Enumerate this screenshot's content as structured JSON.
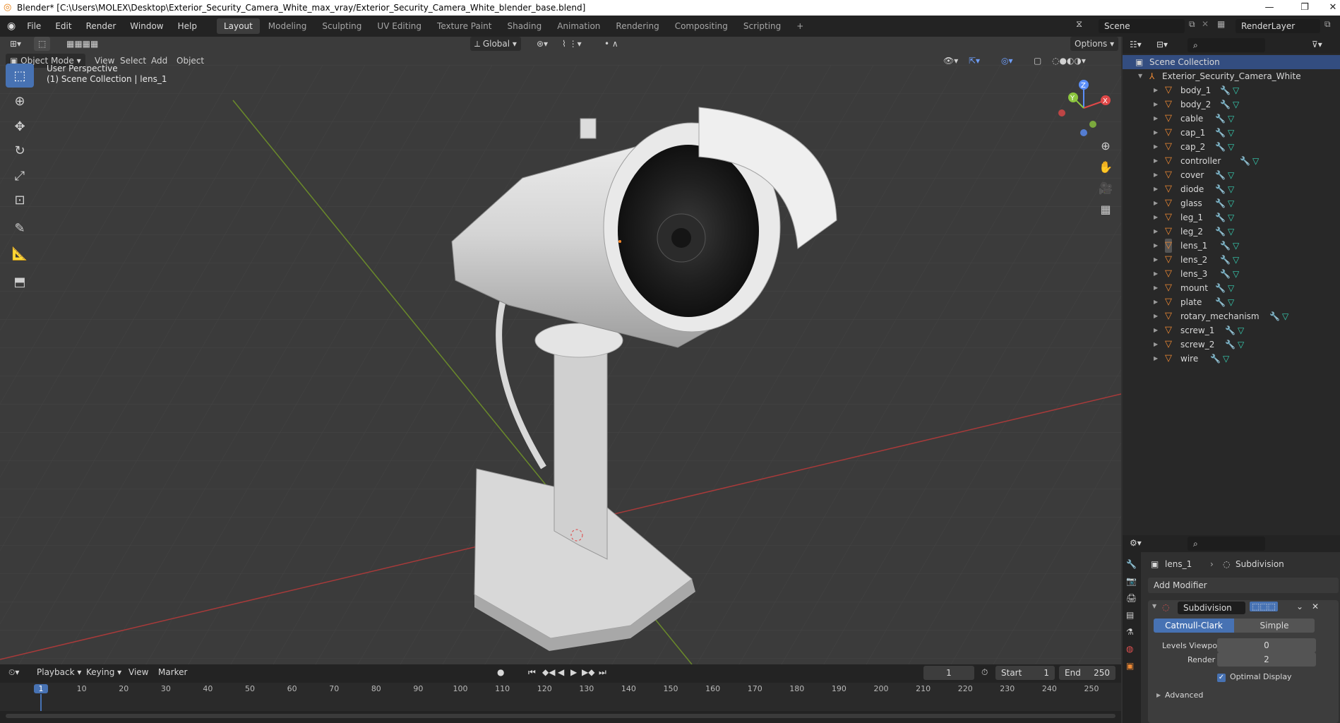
{
  "window": {
    "title": "Blender* [C:\\Users\\MOLEX\\Desktop\\Exterior_Security_Camera_White_max_vray/Exterior_Security_Camera_White_blender_base.blend]"
  },
  "menus": [
    "File",
    "Edit",
    "Render",
    "Window",
    "Help"
  ],
  "workspaces": [
    "Layout",
    "Modeling",
    "Sculpting",
    "UV Editing",
    "Texture Paint",
    "Shading",
    "Animation",
    "Rendering",
    "Compositing",
    "Scripting"
  ],
  "active_workspace": "Layout",
  "scene": {
    "name": "Scene",
    "layer": "RenderLayer"
  },
  "viewport": {
    "mode": "Object Mode",
    "header_menus": [
      "View",
      "Select",
      "Add",
      "Object"
    ],
    "orientation": "Global",
    "options_label": "Options",
    "overlay_line1": "User Perspective",
    "overlay_line2": "(1) Scene Collection | lens_1",
    "gizmo": {
      "x": "X",
      "y": "Y",
      "z": "Z"
    }
  },
  "outliner": {
    "root": "Scene Collection",
    "collection": "Exterior_Security_Camera_White",
    "objects": [
      "body_1",
      "body_2",
      "cable",
      "cap_1",
      "cap_2",
      "controller",
      "cover",
      "diode",
      "glass",
      "leg_1",
      "leg_2",
      "lens_1",
      "lens_2",
      "lens_3",
      "mount",
      "plate",
      "rotary_mechanism",
      "screw_1",
      "screw_2",
      "wire"
    ],
    "active_object": "lens_1"
  },
  "properties": {
    "object": "lens_1",
    "modifier_context": "Subdivision",
    "add_modifier": "Add Modifier",
    "modifier_name": "Subdivision",
    "type_catmull": "Catmull-Clark",
    "type_simple": "Simple",
    "levels_viewport_label": "Levels Viewport",
    "levels_viewport": "0",
    "render_label": "Render",
    "render": "2",
    "optimal_display": "Optimal Display",
    "advanced": "Advanced"
  },
  "timeline": {
    "menus": [
      "Playback",
      "Keying",
      "View",
      "Marker"
    ],
    "current_frame": "1",
    "start_label": "Start",
    "start": "1",
    "end_label": "End",
    "end": "250",
    "ruler": [
      "1",
      "10",
      "20",
      "30",
      "40",
      "50",
      "60",
      "70",
      "80",
      "90",
      "100",
      "110",
      "120",
      "130",
      "140",
      "150",
      "160",
      "170",
      "180",
      "190",
      "200",
      "210",
      "220",
      "230",
      "240",
      "250"
    ]
  },
  "colors": {
    "accent": "#4772b3",
    "object_icon": "#f08a34",
    "mesh_icon": "#37d2b5",
    "wrench_icon": "#7ea7e8"
  }
}
